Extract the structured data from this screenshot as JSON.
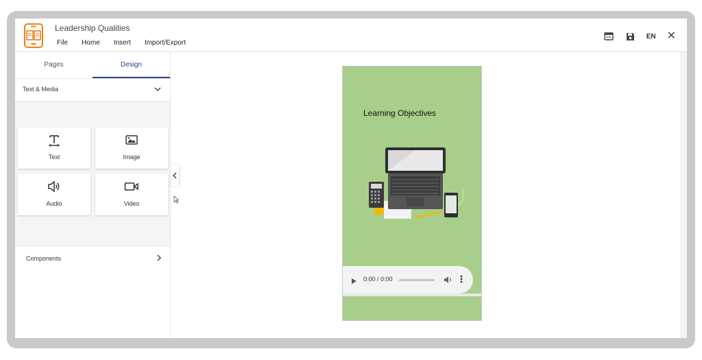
{
  "app": {
    "title": "Leadership Qualities",
    "menu": [
      "File",
      "Home",
      "Insert",
      "Import/Export"
    ],
    "language": "EN",
    "close_symbol": "✕",
    "icons": [
      "book-logo-icon",
      "preview-icon",
      "save-icon",
      "close-icon"
    ],
    "accent_color": "#2a3d8f",
    "logo_color": "#f07f1a"
  },
  "left_panel": {
    "tabs": [
      {
        "label": "Pages",
        "active": false
      },
      {
        "label": "Design",
        "active": true
      }
    ],
    "section": {
      "label": "Text & Media",
      "expanded": true
    },
    "tiles": [
      {
        "label": "Text",
        "icon": "text-icon"
      },
      {
        "label": "Image",
        "icon": "image-icon"
      },
      {
        "label": "Audio",
        "icon": "audio-icon"
      },
      {
        "label": "Video",
        "icon": "video-icon"
      }
    ],
    "components": {
      "label": "Components",
      "expanded": false
    }
  },
  "page": {
    "heading": "Learning Objectives",
    "background": "#a7cf8a",
    "audio": {
      "time": "0:00 / 0:00"
    }
  }
}
